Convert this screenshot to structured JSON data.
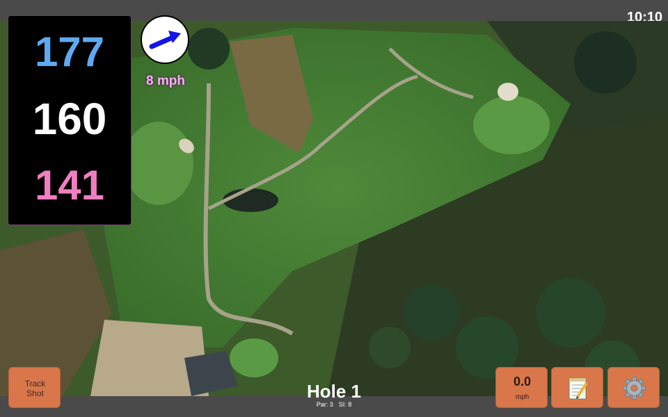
{
  "status": {
    "time": "10:10"
  },
  "distances": {
    "back": "177",
    "center": "160",
    "front": "141"
  },
  "wind": {
    "speed": "8 mph",
    "direction_icon": "arrow-icon"
  },
  "buttons": {
    "track_shot": "Track\nShot",
    "speed_value": "0.0",
    "speed_unit": "mph",
    "notes_icon": "notepad-icon",
    "settings_icon": "gear-icon"
  },
  "hole": {
    "title": "Hole 1",
    "par": "Par: 3",
    "si": "SI: 8"
  },
  "colors": {
    "back_distance": "#5fa9f2",
    "center_distance": "#ffffff",
    "front_distance": "#f07fc0",
    "wind_text": "#f2b6ef",
    "button": "#d9774a"
  }
}
